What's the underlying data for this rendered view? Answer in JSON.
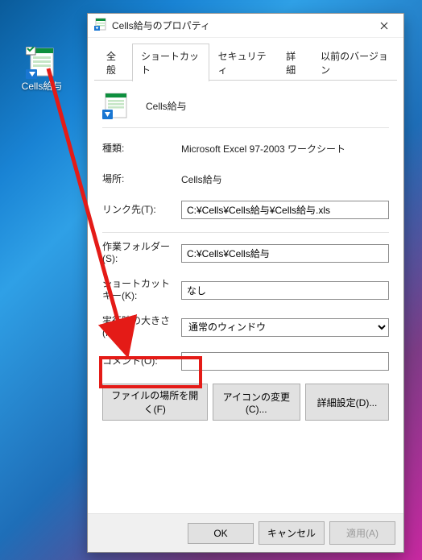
{
  "desktop": {
    "icon_label": "Cells給与"
  },
  "dialog": {
    "title": "Cells給与のプロパティ",
    "tabs": {
      "general": "全般",
      "shortcut": "ショートカット",
      "security": "セキュリティ",
      "details": "詳細",
      "previous": "以前のバージョン"
    },
    "app_name": "Cells給与",
    "fields": {
      "type_label": "種類:",
      "type_value": "Microsoft Excel 97-2003 ワークシート",
      "location_label": "場所:",
      "location_value": "Cells給与",
      "target_label": "リンク先(T):",
      "target_value": "C:¥Cells¥Cells給与¥Cells給与.xls",
      "startin_label": "作業フォルダー(S):",
      "startin_value": "C:¥Cells¥Cells給与",
      "shortcutkey_label": "ショートカット キー(K):",
      "shortcutkey_value": "なし",
      "run_label": "実行時の大きさ(R):",
      "run_value": "通常のウィンドウ",
      "comment_label": "コメント(O):",
      "comment_value": ""
    },
    "buttons": {
      "open_location": "ファイルの場所を開く(F)",
      "change_icon": "アイコンの変更(C)...",
      "advanced": "詳細設定(D)..."
    },
    "footer": {
      "ok": "OK",
      "cancel": "キャンセル",
      "apply": "適用(A)"
    }
  }
}
